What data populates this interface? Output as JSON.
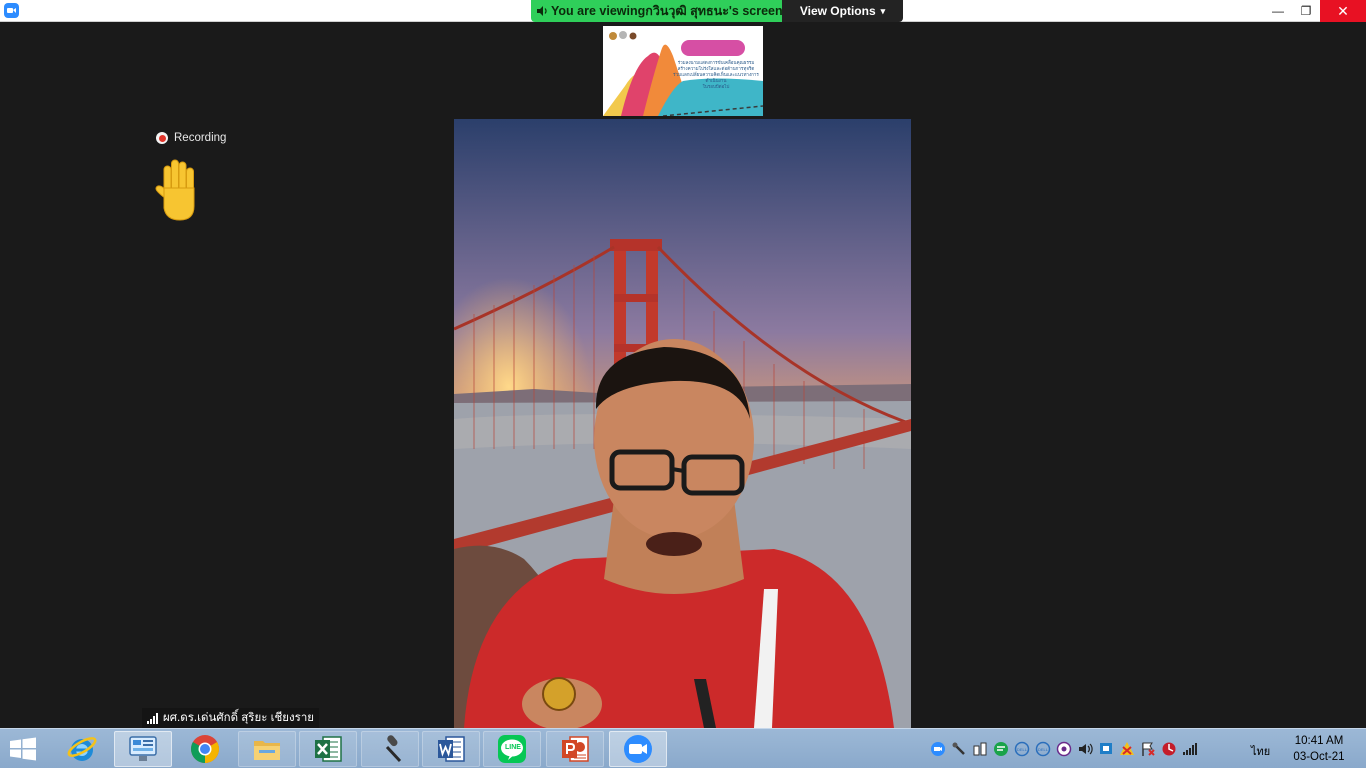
{
  "titlebar": {
    "banner_prefix": "You are viewing ",
    "banner_name": "กวินวุฒิ สุทธนะ's screen",
    "view_options_label": "View Options",
    "caret": "▾",
    "minimize": "—",
    "restore": "❐",
    "close": "✕"
  },
  "meeting": {
    "recording_label": "Recording",
    "participant_name": "ผศ.ดร.เด่นศักดิ์ สุริยะ เชียงราย",
    "shared_screen_text": {
      "line1": "ร่วมลงนามแสดงการขับเคลื่อนคุณธรรม",
      "line2": "สร้างความโปร่งใสและต่อต้านการทุจริต",
      "line3": "ร่วมแลกเปลี่ยนความคิดเห็นและแนวทางการดำเนินงาน",
      "line4": "ในรอบปีต่อไป"
    }
  },
  "taskbar": {
    "apps": [
      {
        "name": "internet-explorer",
        "label": "Internet Explorer"
      },
      {
        "name": "control-panel",
        "label": "Control Panel"
      },
      {
        "name": "chrome",
        "label": "Google Chrome"
      },
      {
        "name": "file-explorer",
        "label": "File Explorer"
      },
      {
        "name": "excel",
        "label": "Excel"
      },
      {
        "name": "microphone",
        "label": "Microphone"
      },
      {
        "name": "word",
        "label": "Word"
      },
      {
        "name": "line",
        "label": "LINE"
      },
      {
        "name": "powerpoint",
        "label": "PowerPoint"
      },
      {
        "name": "zoom",
        "label": "Zoom"
      }
    ],
    "line_text": "LINE",
    "language": "ไทย",
    "time": "10:41 AM",
    "date": "03-Oct-21"
  },
  "colors": {
    "banner_green": "#2fcf5a",
    "close_red": "#e81123",
    "zoom_blue": "#2d8cff",
    "taskbar": "#8aa9cb"
  }
}
